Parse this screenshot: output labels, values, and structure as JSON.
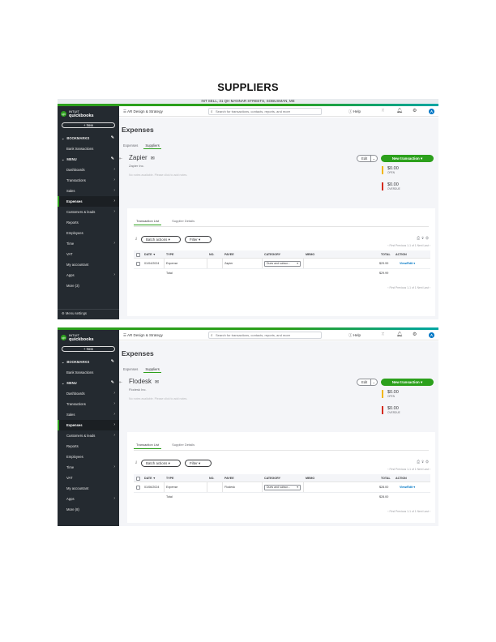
{
  "document": {
    "title": "SUPPLIERS"
  },
  "screens": [
    {
      "overlay": "INT SELL, 31 QH MANNAR STREETS, SOBUSMAN, ME",
      "sidebar": {
        "logo": {
          "brand": "INTUIT",
          "product": "quickbooks"
        },
        "new_label": "+ New",
        "items": [
          {
            "label": "BOOKMARKS",
            "type": "section"
          },
          {
            "label": "Bank transactions",
            "type": "item"
          },
          {
            "label": "MENU",
            "type": "section"
          },
          {
            "label": "Dashboards",
            "type": "item"
          },
          {
            "label": "Transactions",
            "type": "item"
          },
          {
            "label": "Sales",
            "type": "item"
          },
          {
            "label": "Expenses",
            "type": "item",
            "active": true
          },
          {
            "label": "Customers & leads",
            "type": "item"
          },
          {
            "label": "Reports",
            "type": "item"
          },
          {
            "label": "Employees",
            "type": "item"
          },
          {
            "label": "Time",
            "type": "item"
          },
          {
            "label": "VAT",
            "type": "item"
          },
          {
            "label": "My accountant",
            "type": "item"
          },
          {
            "label": "Apps",
            "type": "item"
          },
          {
            "label": "More (3)",
            "type": "item"
          }
        ],
        "menu_settings": "Menu settings"
      },
      "topbar": {
        "company": "AR Design & Strategy",
        "search_placeholder": "Search for transactions, contacts, reports, and more",
        "help": "Help",
        "avatar": "A"
      },
      "page_title": "Expenses",
      "tabs": [
        "Expenses",
        "Suppliers"
      ],
      "supplier": {
        "name": "Zapier",
        "company": "Zapier Inc.",
        "note": "No notes available. Please click to add notes.",
        "edit_label": "Edit",
        "new_transaction_label": "New transaction",
        "open_amount": "$0.00",
        "open_label": "OPEN",
        "overdue_amount": "$0.00",
        "overdue_label": "OVERDUE"
      },
      "transactions": {
        "tabs": [
          "Transaction List",
          "Supplier Details"
        ],
        "batch_label": "Batch actions",
        "filter_label": "Filter",
        "pager": "‹ First   Previous   1-1 of 1   Next   Last ›",
        "columns": [
          "DATE ▼",
          "TYPE",
          "NO.",
          "PAYEE",
          "CATEGORY",
          "MEMO",
          "TOTAL",
          "ACTION"
        ],
        "row": {
          "date": "01/04/2024",
          "type": "Expense",
          "no": "",
          "payee": "Zapier",
          "category": "Dues and subscr...",
          "memo": "",
          "total": "$29.99",
          "action": "View/Edit"
        },
        "total_label": "Total",
        "total_value": "$29.99"
      }
    },
    {
      "sidebar": {
        "logo": {
          "brand": "INTUIT",
          "product": "quickbooks"
        },
        "new_label": "+ New",
        "items": [
          {
            "label": "BOOKMARKS",
            "type": "section"
          },
          {
            "label": "Bank transactions",
            "type": "item"
          },
          {
            "label": "MENU",
            "type": "section"
          },
          {
            "label": "Dashboards",
            "type": "item"
          },
          {
            "label": "Transactions",
            "type": "item"
          },
          {
            "label": "Sales",
            "type": "item"
          },
          {
            "label": "Expenses",
            "type": "item",
            "active": true
          },
          {
            "label": "Customers & leads",
            "type": "item"
          },
          {
            "label": "Reports",
            "type": "item"
          },
          {
            "label": "Employees",
            "type": "item"
          },
          {
            "label": "Time",
            "type": "item"
          },
          {
            "label": "VAT",
            "type": "item"
          },
          {
            "label": "My accountant",
            "type": "item"
          },
          {
            "label": "Apps",
            "type": "item"
          },
          {
            "label": "More (8)",
            "type": "item"
          }
        ]
      },
      "topbar": {
        "company": "AR Design & Strategy",
        "search_placeholder": "Search for transactions, contacts, reports, and more",
        "help": "Help",
        "avatar": "A"
      },
      "page_title": "Expenses",
      "tabs": [
        "Expenses",
        "Suppliers"
      ],
      "supplier": {
        "name": "Flodesk",
        "company": "Flodesk Inc.",
        "note": "No notes available. Please click to add notes.",
        "edit_label": "Edit",
        "new_transaction_label": "New transaction",
        "open_amount": "$0.00",
        "open_label": "OPEN",
        "overdue_amount": "$0.00",
        "overdue_label": "OVERDUE"
      },
      "transactions": {
        "tabs": [
          "Transaction List",
          "Supplier Details"
        ],
        "batch_label": "Batch actions",
        "filter_label": "Filter",
        "pager": "‹ First   Previous   1-1 of 1   Next   Last ›",
        "columns": [
          "DATE ▼",
          "TYPE",
          "NO.",
          "PAYEE",
          "CATEGORY",
          "MEMO",
          "TOTAL",
          "ACTION"
        ],
        "row": {
          "date": "01/06/2024",
          "type": "Expense",
          "no": "",
          "payee": "Flodesk",
          "category": "Dues and subscr...",
          "memo": "",
          "total": "$28.00",
          "action": "View/Edit"
        },
        "total_label": "Total",
        "total_value": "$28.00"
      }
    }
  ]
}
